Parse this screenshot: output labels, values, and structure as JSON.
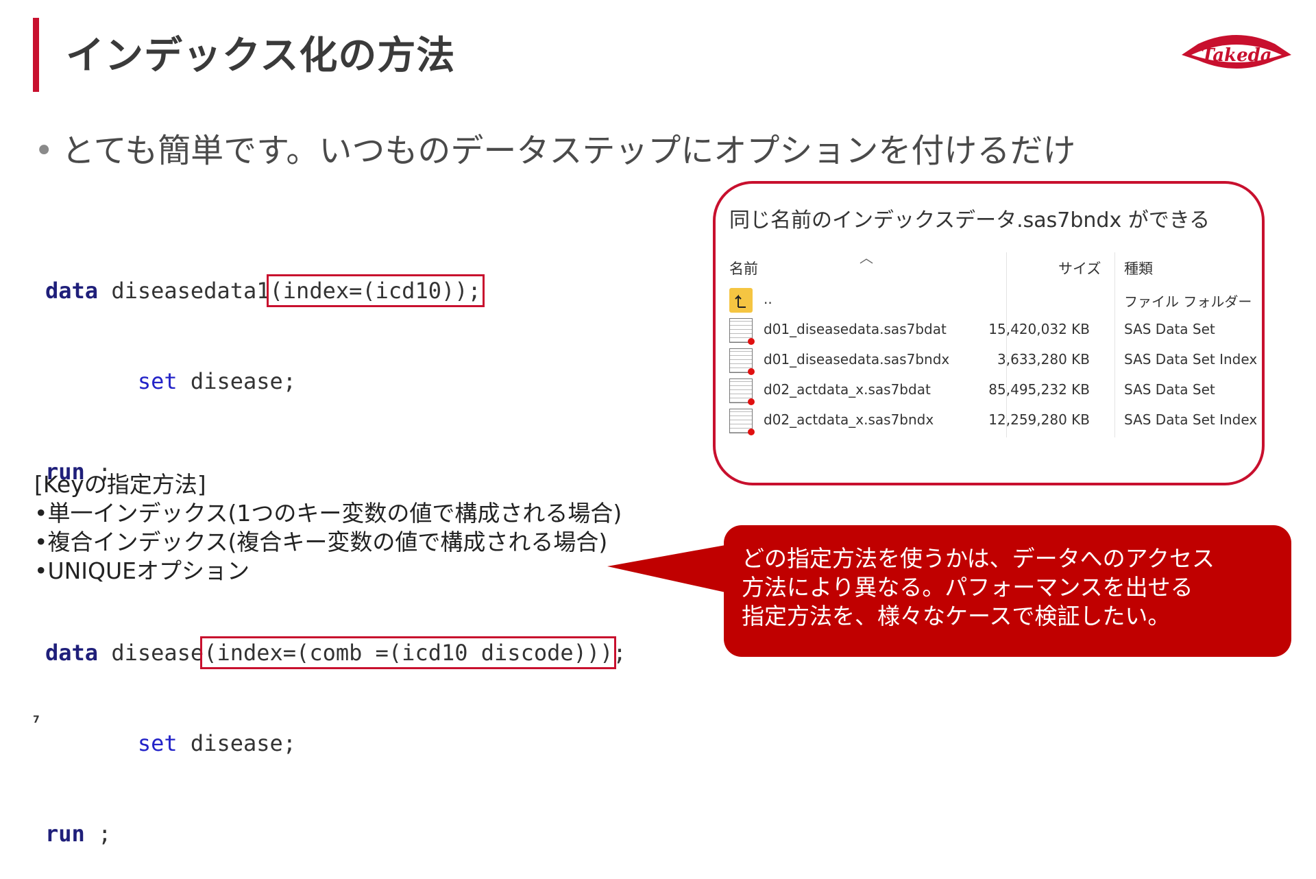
{
  "title": "インデックス化の方法",
  "logo_text": "Takeda",
  "brand_color": "#c8102e",
  "bullet": "とても簡単です。いつものデータステップにオプションを付けるだけ",
  "code": {
    "l1": {
      "kw": "data",
      "name": " diseasedata1",
      "opt": "(index=(icd10));"
    },
    "l2": {
      "indent": "       ",
      "set": "set",
      "rest": " disease;"
    },
    "l3": {
      "kw": "run",
      "rest": " ;"
    },
    "l5": {
      "kw": "data",
      "name": " disease",
      "opt": "(index=(comb =(icd10 discode)))",
      "tail": ";"
    },
    "l6": {
      "indent": "       ",
      "set": "set",
      "rest": " disease;"
    },
    "l7": {
      "kw": "run",
      "rest": " ;"
    }
  },
  "keys": {
    "heading": "[Keyの指定方法]",
    "items": [
      "•単一インデックス(1つのキー変数の値で構成される場合)",
      "•複合インデックス(複合キー変数の値で構成される場合)",
      "•UNIQUEオプション"
    ]
  },
  "explorer": {
    "title": "同じ名前のインデックスデータ.sas7bndx ができる",
    "headers": {
      "name": "名前",
      "size": "サイズ",
      "type": "種類"
    },
    "rows": [
      {
        "icon": "folder-up-icon",
        "name": "..",
        "size": "",
        "type": "ファイル フォルダー"
      },
      {
        "icon": "sas-dataset-icon",
        "name": "d01_diseasedata.sas7bdat",
        "size": "15,420,032 KB",
        "type": "SAS Data Set"
      },
      {
        "icon": "sas-index-icon",
        "name": "d01_diseasedata.sas7bndx",
        "size": "3,633,280 KB",
        "type": "SAS Data Set Index"
      },
      {
        "icon": "sas-dataset-icon",
        "name": "d02_actdata_x.sas7bdat",
        "size": "85,495,232 KB",
        "type": "SAS Data Set"
      },
      {
        "icon": "sas-index-icon",
        "name": "d02_actdata_x.sas7bndx",
        "size": "12,259,280 KB",
        "type": "SAS Data Set Index"
      }
    ]
  },
  "callout": {
    "lines": [
      "どの指定方法を使うかは、データへのアクセス",
      "方法により異なる。パフォーマンスを出せる",
      "指定方法を、様々なケースで検証したい。"
    ]
  },
  "page_number": "7"
}
